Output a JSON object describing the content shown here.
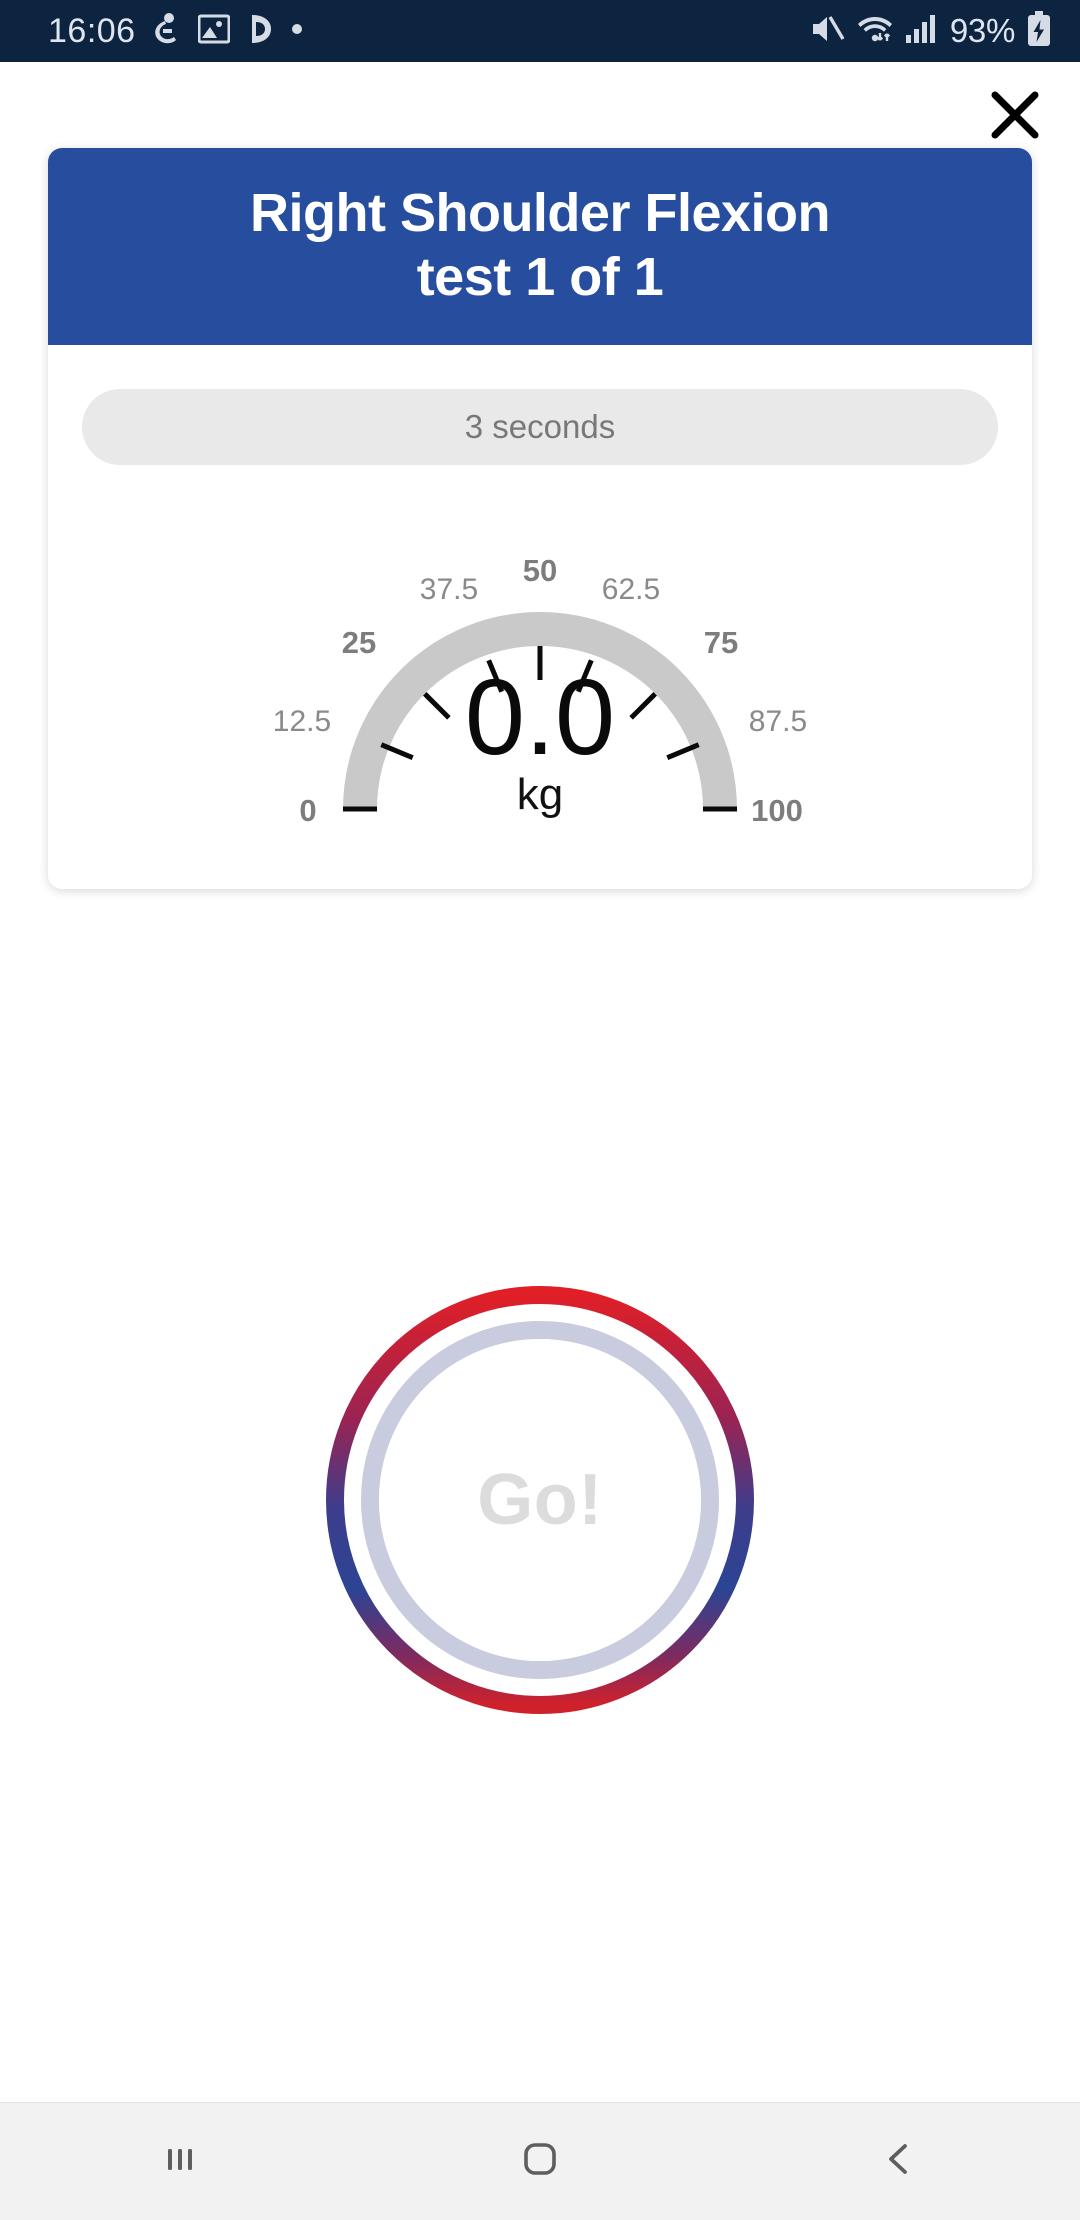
{
  "status_bar": {
    "time": "16:06",
    "battery_percent": "93%",
    "icons": [
      "diver-icon",
      "gallery-icon",
      "app-icon",
      "dot-icon",
      "mute-icon",
      "wifi-icon",
      "signal-icon",
      "battery-charging-icon"
    ]
  },
  "close_button": {
    "icon": "close-icon",
    "label": "Close"
  },
  "card": {
    "title": "Right Shoulder Flexion\ntest 1 of 1",
    "header_color": "#264d9e",
    "timer": {
      "text": "3 seconds"
    }
  },
  "gauge": {
    "value": "0.0",
    "unit": "kg",
    "min": 0,
    "max": 100,
    "current": 0,
    "arc_color": "#c9c9c9",
    "tick_color": "#000000",
    "ticks": [
      {
        "label": "0",
        "value": 0,
        "major": true
      },
      {
        "label": "12.5",
        "value": 12.5,
        "major": false
      },
      {
        "label": "25",
        "value": 25,
        "major": true
      },
      {
        "label": "37.5",
        "value": 37.5,
        "major": false
      },
      {
        "label": "50",
        "value": 50,
        "major": true
      },
      {
        "label": "62.5",
        "value": 62.5,
        "major": false
      },
      {
        "label": "75",
        "value": 75,
        "major": true
      },
      {
        "label": "87.5",
        "value": 87.5,
        "major": false
      },
      {
        "label": "100",
        "value": 100,
        "major": true
      }
    ]
  },
  "go_button": {
    "label": "Go!",
    "outer_ring_top_color": "#e01f27",
    "outer_ring_bottom_color": "#2c4493",
    "inner_ring_color": "#c9cbde",
    "label_color": "#dcdcdc"
  },
  "nav_bar": {
    "recents_label": "Recents",
    "home_label": "Home",
    "back_label": "Back"
  },
  "chart_data": {
    "type": "gauge",
    "title": "Right Shoulder Flexion test 1 of 1",
    "value": 0.0,
    "unit": "kg",
    "min": 0,
    "max": 100,
    "tick_values": [
      0,
      12.5,
      25,
      37.5,
      50,
      62.5,
      75,
      87.5,
      100
    ],
    "tick_labels": [
      "0",
      "12.5",
      "25",
      "37.5",
      "50",
      "62.5",
      "75",
      "87.5",
      "100"
    ],
    "major_ticks": [
      0,
      25,
      50,
      75,
      100
    ],
    "arc_start_angle_deg": 180,
    "arc_end_angle_deg": 360,
    "filled_fraction": 0.0,
    "grid": false,
    "legend": "none"
  }
}
